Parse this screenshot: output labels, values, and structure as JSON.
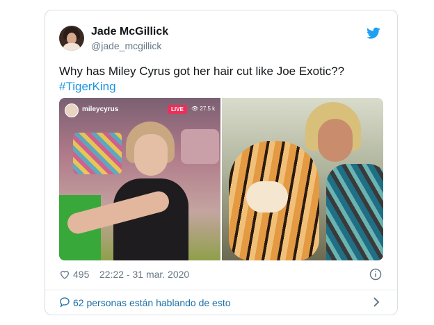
{
  "tweet": {
    "author_name": "Jade McGillick",
    "handle": "@jade_mcgillick",
    "text": "Why has Miley Cyrus got her hair cut like Joe Exotic??",
    "hashtag": "#TigerKing",
    "likes": "495",
    "timestamp": "22:22 - 31 mar. 2020",
    "talking": "62 personas están hablando de esto"
  },
  "media": {
    "left": {
      "ig_username": "mileycyrus",
      "live_badge": "LIVE",
      "viewers": "27.5 k"
    }
  },
  "colors": {
    "twitter_blue": "#1da1f2",
    "link_blue": "#1b95e0",
    "muted": "#657786",
    "live_red": "#e9305a"
  },
  "icons": [
    "twitter-bird-icon",
    "heart-icon",
    "info-icon",
    "chat-bubble-icon",
    "chevron-right-icon",
    "eye-icon"
  ]
}
